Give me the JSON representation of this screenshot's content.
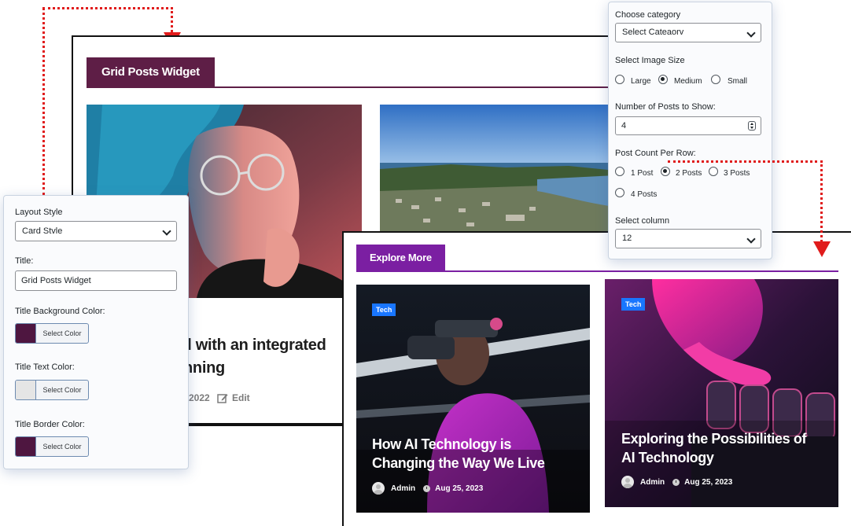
{
  "grid_preview": {
    "title": "Grid Posts Widget",
    "title_bg": "#5e1e46",
    "post_title_lines": [
      "ll with an integrated",
      "nning"
    ],
    "post_date": "2022",
    "edit_label": "Edit"
  },
  "layout_panel": {
    "layout_style_label": "Layout Style",
    "layout_style_value": "Card Stvle",
    "title_label": "Title:",
    "title_value": "Grid Posts Widget",
    "title_bg_label": "Title Background Color:",
    "title_text_label": "Title Text Color:",
    "title_border_label": "Title Border Color:",
    "select_color": "Select Color",
    "swatches": {
      "bg": "#4e1640",
      "text": "#e5e5e5",
      "border": "#4e1640"
    }
  },
  "query_panel": {
    "category_label": "Choose category",
    "category_value": "Select Cateaorv",
    "image_size_label": "Select Image Size",
    "image_sizes": [
      "Large",
      "Medium",
      "Small"
    ],
    "image_size_selected": "Medium",
    "posts_count_label": "Number of Posts to Show:",
    "posts_count_value": "4",
    "per_row_label": "Post Count Per Row:",
    "per_row_options": [
      "1 Post",
      "2 Posts",
      "3 Posts",
      "4 Posts"
    ],
    "per_row_selected": "2 Posts",
    "column_label": "Select column",
    "column_value": "12"
  },
  "explore_preview": {
    "title": "Explore More",
    "title_bg": "#7b1fa2",
    "posts": [
      {
        "tag": "Tech",
        "title_lines": [
          "How AI Technology is",
          "Changing the Way We Live"
        ],
        "author": "Admin",
        "date": "Aug 25, 2023"
      },
      {
        "tag": "Tech",
        "title_lines": [
          "Exploring the Possibilities of",
          "AI Technology"
        ],
        "author": "Admin",
        "date": "Aug 25, 2023"
      }
    ]
  },
  "colors": {
    "connector": "#e01b1b",
    "tag": "#1976ff"
  }
}
